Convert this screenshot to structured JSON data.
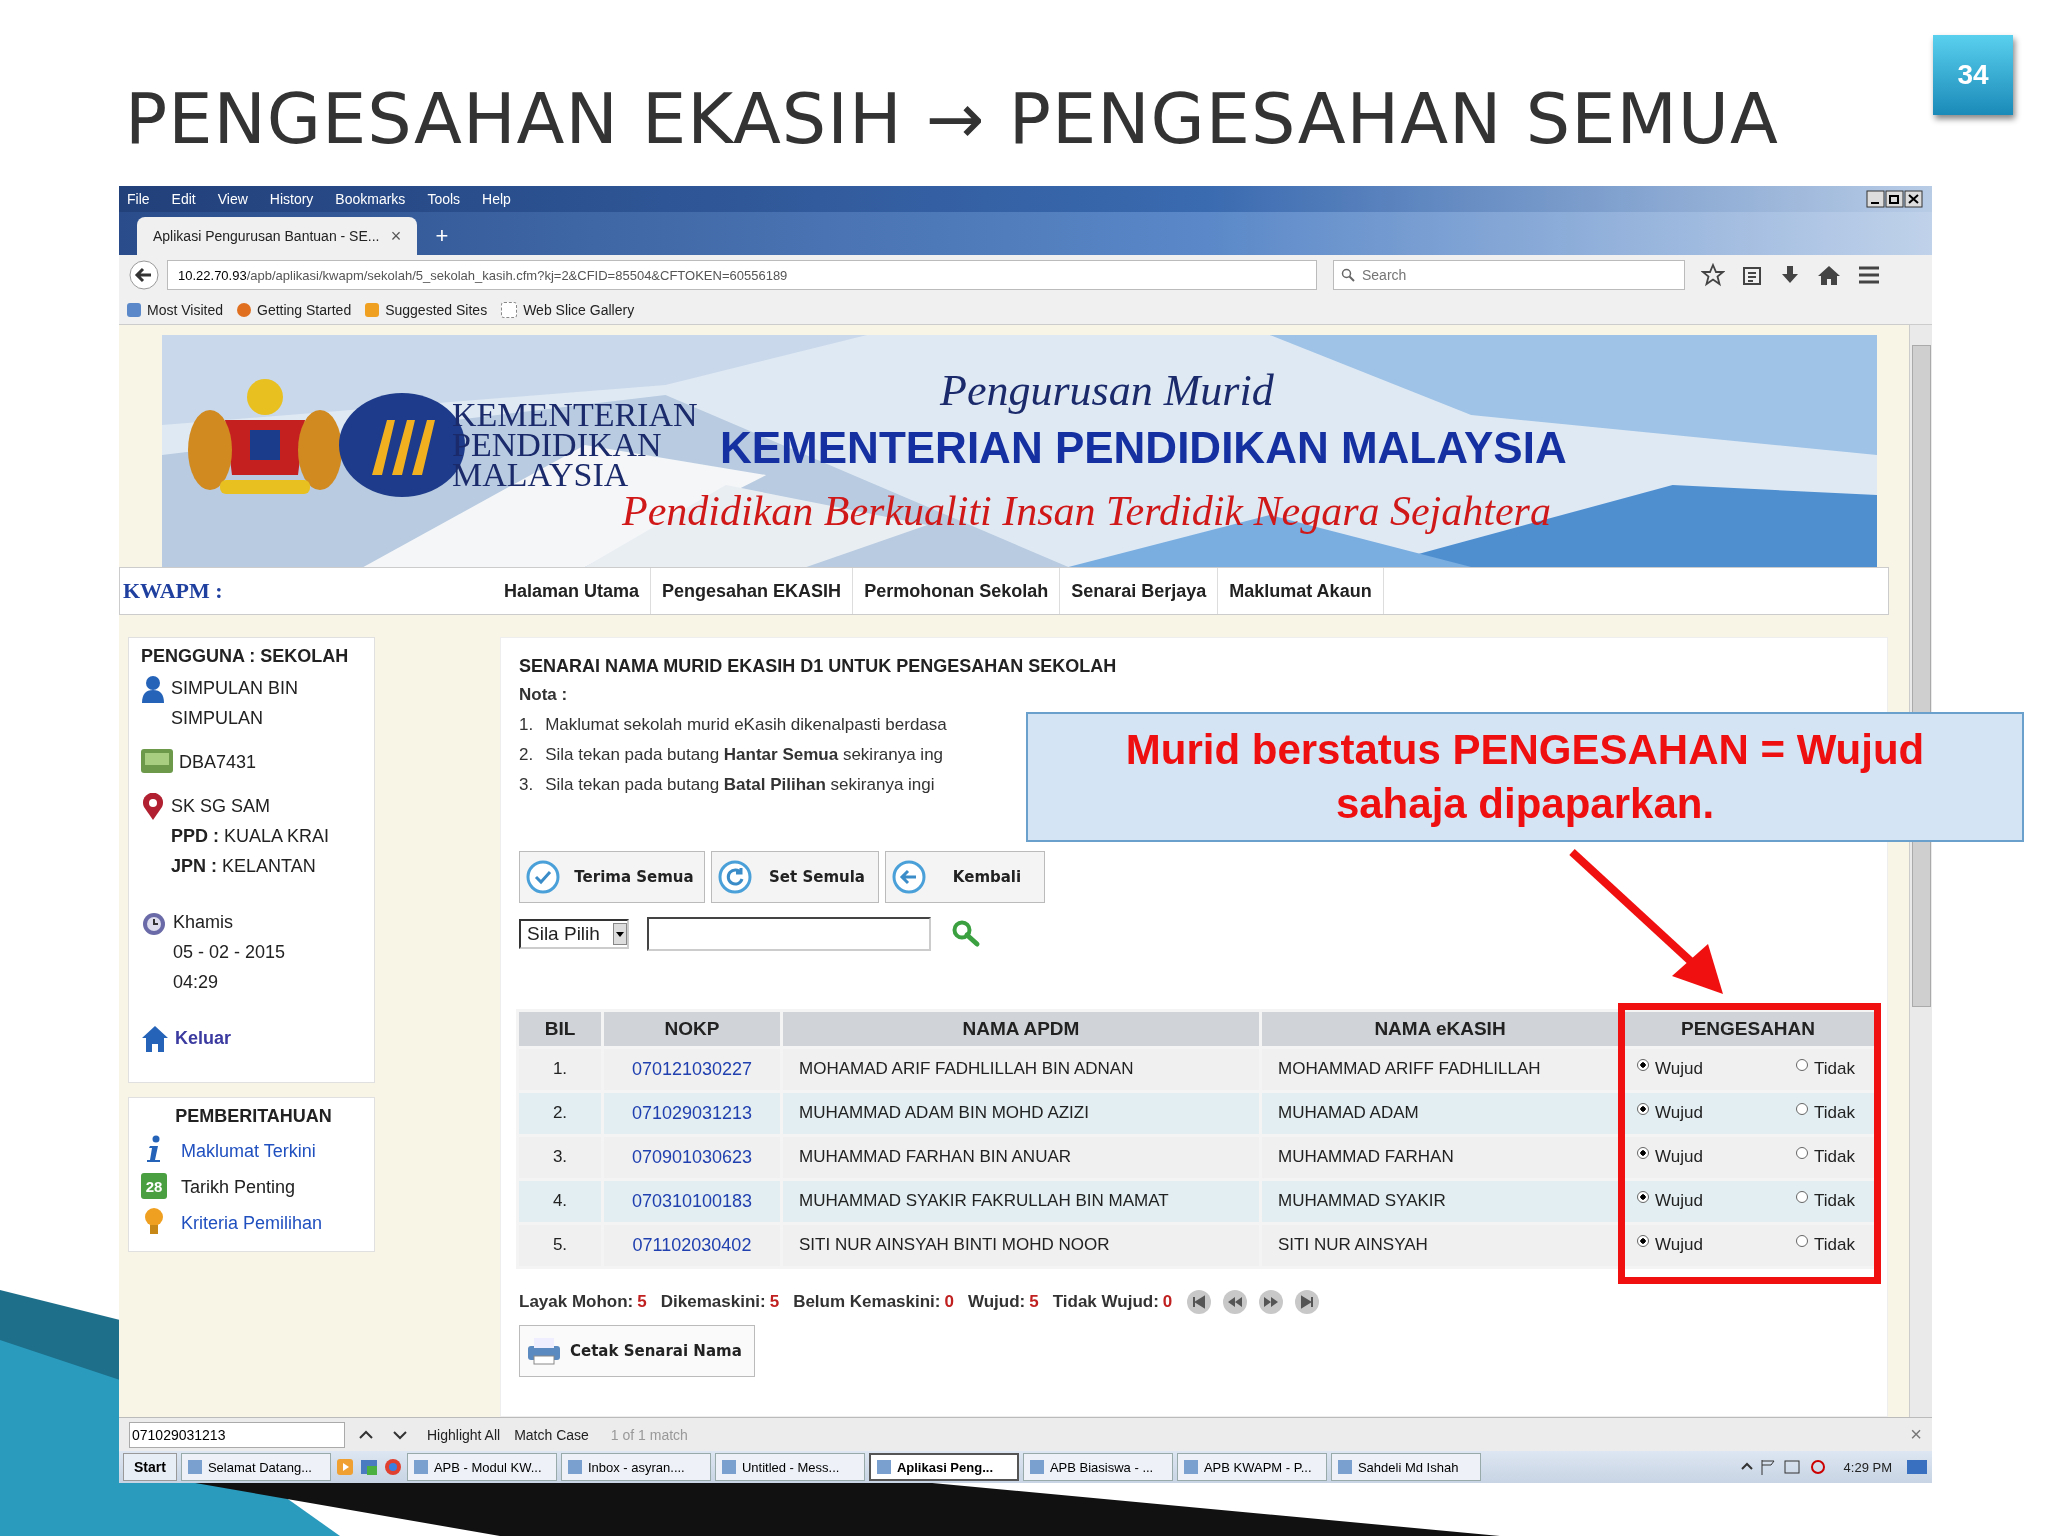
{
  "slide": {
    "title": "PENGESAHAN EKASIH → PENGESAHAN SEMUA",
    "number": "34"
  },
  "browser": {
    "menu": [
      "File",
      "Edit",
      "View",
      "History",
      "Bookmarks",
      "Tools",
      "Help"
    ],
    "tab": {
      "title": "Aplikasi Pengurusan Bantuan - SE...",
      "close": "×"
    },
    "new_tab": "+",
    "address": {
      "host": "10.22.70.93",
      "path": "/apb/aplikasi/kwapm/sekolah/5_sekolah_kasih.cfm?kj=2&CFID=85504&CFTOKEN=60556189"
    },
    "search": {
      "placeholder": "Search"
    },
    "bookmarks": [
      "Most Visited",
      "Getting Started",
      "Suggested Sites",
      "Web Slice Gallery"
    ]
  },
  "banner": {
    "subtitle": "Pengurusan Murid",
    "logo_lines": [
      "KEMENTERIAN",
      "PENDIDIKAN",
      "MALAYSIA"
    ],
    "heading": "KEMENTERIAN PENDIDIKAN MALAYSIA",
    "motto": "Pendidikan Berkualiti Insan Terdidik Negara Sejahtera"
  },
  "nav": {
    "brand": "KWAPM :",
    "items": [
      "Halaman Utama",
      "Pengesahan EKASIH",
      "Permohonan Sekolah",
      "Senarai Berjaya",
      "Maklumat Akaun"
    ]
  },
  "sidebar": {
    "user": {
      "heading": "PENGGUNA : SEKOLAH",
      "name": "SIMPULAN BIN SIMPULAN",
      "code": "DBA7431",
      "school": "SK SG SAM",
      "details": [
        {
          "label": "PPD :",
          "value": "KUALA KRAI"
        },
        {
          "label": "JPN :",
          "value": "KELANTAN"
        }
      ],
      "day": "Khamis",
      "date": "05 - 02 - 2015",
      "time": "04:29",
      "logout": "Keluar"
    },
    "notices": {
      "heading": "PEMBERITAHUAN",
      "items": [
        {
          "label": "Maklumat Terkini",
          "kind": "link"
        },
        {
          "label": "Tarikh Penting",
          "kind": "plain",
          "badge": "28"
        },
        {
          "label": "Kriteria Pemilihan",
          "kind": "link"
        }
      ]
    }
  },
  "main": {
    "heading": "SENARAI NAMA MURID EKASIH D1 UNTUK PENGESAHAN SEKOLAH",
    "nota_label": "Nota :",
    "notes": [
      {
        "num": "1.",
        "text": "Maklumat sekolah murid eKasih dikenalpasti berdasa"
      },
      {
        "num": "2.",
        "text": "Sila tekan pada butang **Hantar Semua** sekiranya ing"
      },
      {
        "num": "3.",
        "text": "Sila tekan pada butang **Batal Pilihan** sekiranya ingi"
      }
    ],
    "actions": [
      "Terima Semua",
      "Set Semula",
      "Kembali"
    ],
    "filter": {
      "select": "Sila Pilih"
    },
    "table": {
      "columns": [
        "BIL",
        "NOKP",
        "NAMA APDM",
        "NAMA eKASIH",
        "PENGESAHAN"
      ],
      "rows": [
        {
          "bil": "1.",
          "nokp": "070121030227",
          "apdm": "MOHAMAD ARIF FADHLILLAH BIN ADNAN",
          "ekasih": "MOHAMMAD ARIFF FADHLILLAH",
          "options": [
            {
              "label": "Wujud",
              "selected": true
            },
            {
              "label": "Tidak",
              "selected": false
            }
          ]
        },
        {
          "bil": "2.",
          "nokp": "071029031213",
          "apdm": "MUHAMMAD ADAM BIN MOHD AZIZI",
          "ekasih": "MUHAMAD ADAM",
          "options": [
            {
              "label": "Wujud",
              "selected": true
            },
            {
              "label": "Tidak",
              "selected": false
            }
          ]
        },
        {
          "bil": "3.",
          "nokp": "070901030623",
          "apdm": "MUHAMMAD FARHAN BIN ANUAR",
          "ekasih": "MUHAMMAD FARHAN",
          "options": [
            {
              "label": "Wujud",
              "selected": true
            },
            {
              "label": "Tidak",
              "selected": false
            }
          ]
        },
        {
          "bil": "4.",
          "nokp": "070310100183",
          "apdm": "MUHAMMAD SYAKIR FAKRULLAH BIN MAMAT",
          "ekasih": "MUHAMMAD SYAKIR",
          "options": [
            {
              "label": "Wujud",
              "selected": true
            },
            {
              "label": "Tidak",
              "selected": false
            }
          ]
        },
        {
          "bil": "5.",
          "nokp": "071102030402",
          "apdm": "SITI NUR AINSYAH BINTI MOHD NOOR",
          "ekasih": "SITI NUR AINSYAH",
          "options": [
            {
              "label": "Wujud",
              "selected": true
            },
            {
              "label": "Tidak",
              "selected": false
            }
          ]
        }
      ]
    },
    "summary": [
      {
        "label": "Layak Mohon:",
        "value": "5"
      },
      {
        "label": "Dikemaskini:",
        "value": "5"
      },
      {
        "label": "Belum Kemaskini:",
        "value": "0"
      },
      {
        "label": "Wujud:",
        "value": "5"
      },
      {
        "label": "Tidak Wujud:",
        "value": "0"
      }
    ],
    "print": "Cetak Senarai Nama"
  },
  "find_bar": {
    "value": "071029031213",
    "highlight": "Highlight All",
    "match": "Match Case",
    "status": "1 of 1 match",
    "close": "×"
  },
  "taskbar": {
    "start": "Start",
    "items": [
      {
        "label": "Selamat Datang...",
        "selected": false
      },
      {
        "label": "APB - Modul KW...",
        "selected": false
      },
      {
        "label": "Inbox - asyran....",
        "selected": false
      },
      {
        "label": "Untitled - Mess...",
        "selected": false
      },
      {
        "label": "Aplikasi Peng...",
        "selected": true
      },
      {
        "label": "APB Biasiswa - ...",
        "selected": false
      },
      {
        "label": "APB KWAPM - P...",
        "selected": false
      },
      {
        "label": "Sahdeli Md Ishah",
        "selected": false
      }
    ],
    "clock": "4:29 PM"
  },
  "callout": {
    "text": "Murid berstatus PENGESAHAN = Wujud sahaja dipaparkan."
  }
}
